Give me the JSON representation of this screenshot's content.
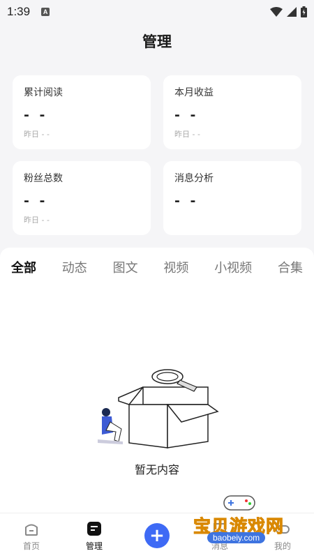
{
  "status_bar": {
    "time": "1:39",
    "notification_icon": "A"
  },
  "header": {
    "title": "管理"
  },
  "stats": [
    {
      "label": "累计阅读",
      "value": "- -",
      "sub": "昨日 - -"
    },
    {
      "label": "本月收益",
      "value": "- -",
      "sub": "昨日 - -"
    },
    {
      "label": "粉丝总数",
      "value": "- -",
      "sub": "昨日 - -"
    },
    {
      "label": "消息分析",
      "value": "- -"
    }
  ],
  "tabs": [
    {
      "label": "全部",
      "active": true
    },
    {
      "label": "动态"
    },
    {
      "label": "图文"
    },
    {
      "label": "视频"
    },
    {
      "label": "小视频"
    },
    {
      "label": "合集"
    }
  ],
  "empty_state": {
    "text": "暂无内容",
    "icon": "empty-box-illustration"
  },
  "bottom_nav": [
    {
      "label": "首页",
      "icon": "home-icon"
    },
    {
      "label": "管理",
      "icon": "manage-icon",
      "active": true
    },
    {
      "label": "",
      "icon": "add-icon"
    },
    {
      "label": "消息",
      "icon": "message-icon"
    },
    {
      "label": "我的",
      "icon": "profile-icon"
    }
  ],
  "watermark": {
    "text": "宝贝游戏网",
    "url": "baobeiy.com"
  },
  "colors": {
    "accent": "#3e6af5",
    "background": "#f5f5f7",
    "watermark": "#f1a11f"
  }
}
